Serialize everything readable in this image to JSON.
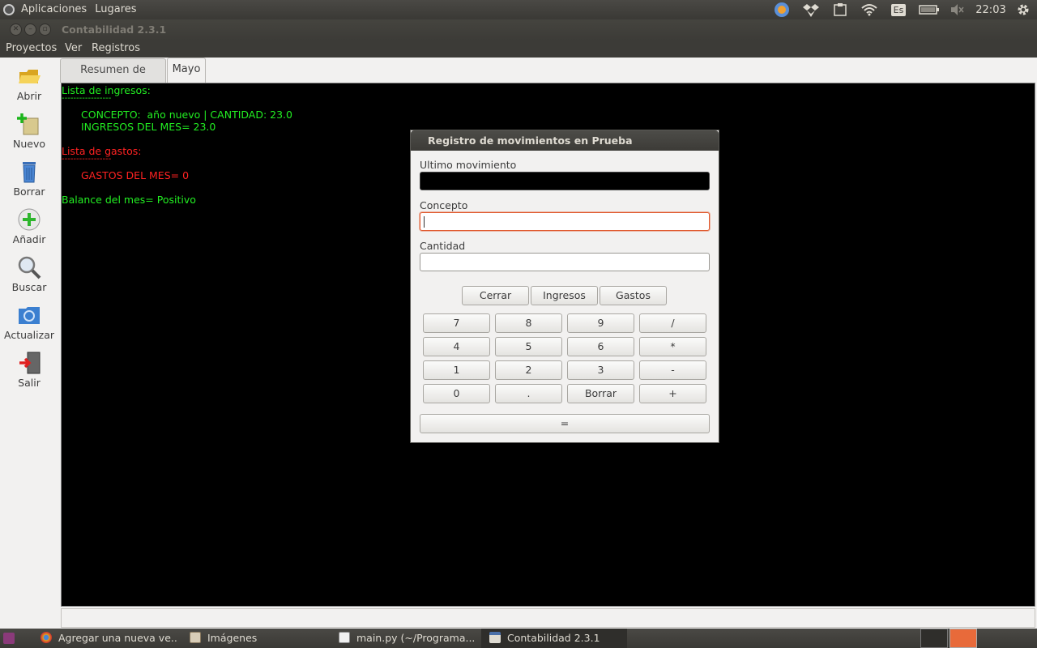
{
  "top_panel": {
    "menu": [
      "Aplicaciones",
      "Lugares"
    ],
    "keyboard_layout": "Es",
    "clock": "22:03"
  },
  "window": {
    "title": "Contabilidad 2.3.1"
  },
  "menubar": [
    "Proyectos",
    "Ver",
    "Registros"
  ],
  "toolbar": [
    {
      "label": "Abrir",
      "icon": "folder-open-icon"
    },
    {
      "label": "Nuevo",
      "icon": "new-folder-icon"
    },
    {
      "label": "Borrar",
      "icon": "trash-icon"
    },
    {
      "label": "Añadir",
      "icon": "add-icon"
    },
    {
      "label": "Buscar",
      "icon": "magnifier-icon"
    },
    {
      "label": "Actualizar",
      "icon": "refresh-icon"
    },
    {
      "label": "Salir",
      "icon": "exit-icon"
    }
  ],
  "tabs": [
    {
      "label": "Resumen de Prueba",
      "active": false
    },
    {
      "label": "Mayo",
      "active": true
    }
  ],
  "console": {
    "income_header": "Lista de ingresos:",
    "income_rule": "-----------------",
    "income_item": "CONCEPTO:  año nuevo | CANTIDAD: 23.0",
    "income_total": "INGRESOS DEL MES= 23.0",
    "expense_header": "Lista de gastos:",
    "expense_rule": "-----------------",
    "expense_total": "GASTOS DEL MES= 0",
    "balance": "Balance del mes= Positivo",
    "colors": {
      "income": "#22ee22",
      "expense": "#ff2222",
      "background": "#000000"
    }
  },
  "dialog": {
    "title": "Registro de movimientos en Prueba",
    "last_movement_label": "Ultimo movimiento",
    "last_movement_value": "",
    "concept_label": "Concepto",
    "concept_value": "",
    "amount_label": "Cantidad",
    "amount_value": "",
    "actions": [
      "Cerrar",
      "Ingresos",
      "Gastos"
    ],
    "keypad": [
      [
        "7",
        "8",
        "9",
        "/"
      ],
      [
        "4",
        "5",
        "6",
        "*"
      ],
      [
        "1",
        "2",
        "3",
        "-"
      ],
      [
        "0",
        ".",
        "Borrar",
        "+"
      ]
    ],
    "equals": "="
  },
  "taskbar": [
    {
      "label": "Agregar una nueva ve...",
      "icon": "chrome-icon",
      "active": false
    },
    {
      "label": "Imágenes",
      "icon": "file-manager-icon",
      "active": false
    },
    {
      "label": "main.py (~/Programa...",
      "icon": "text-editor-icon",
      "active": false
    },
    {
      "label": "Contabilidad 2.3.1",
      "icon": "window-icon",
      "active": true
    }
  ]
}
